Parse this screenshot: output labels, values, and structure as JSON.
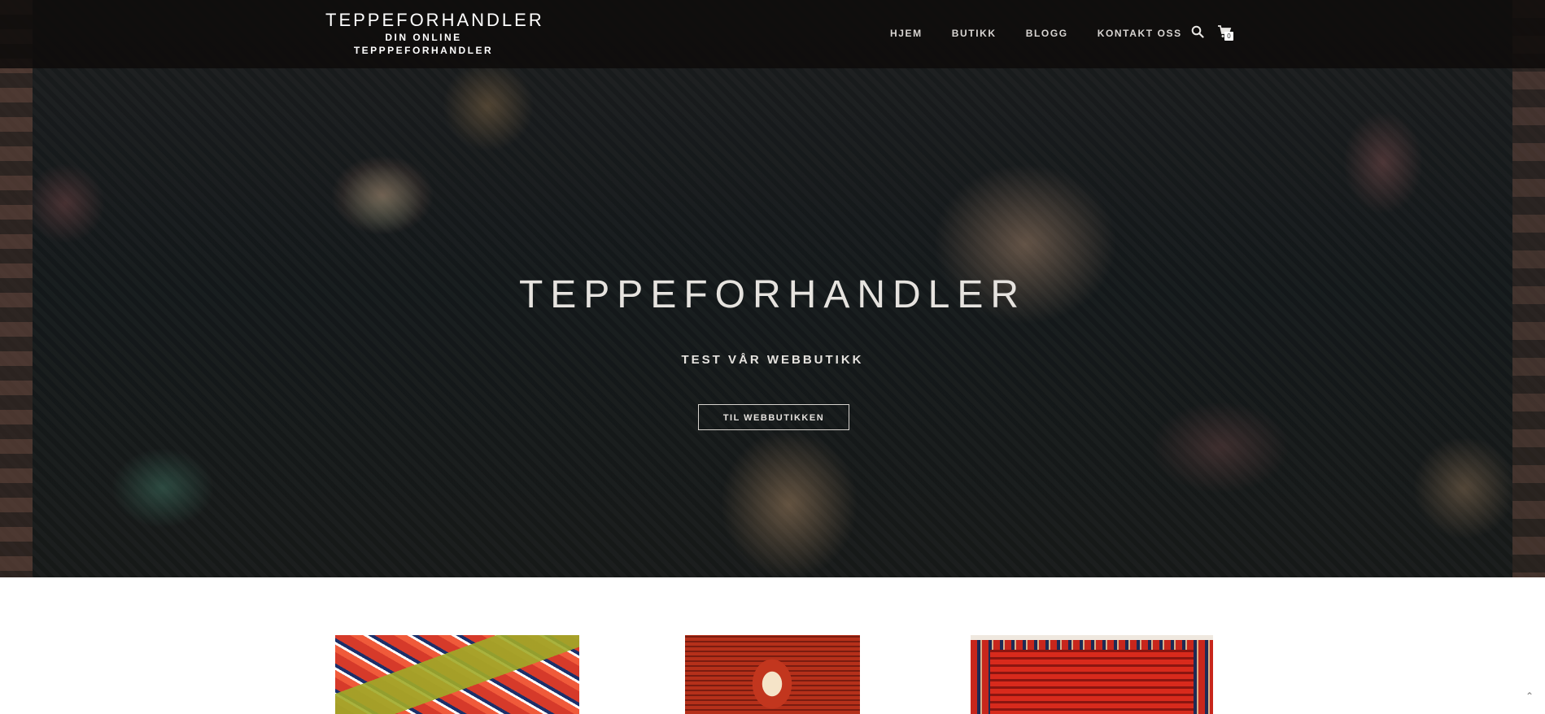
{
  "site": {
    "title": "TEPPEFORHANDLER",
    "tagline": "DIN ONLINE TEPPPEFORHANDLER"
  },
  "nav": {
    "items": [
      "HJEM",
      "BUTIKK",
      "BLOGG",
      "KONTAKT OSS"
    ]
  },
  "header_icons": {
    "search": "search-icon",
    "cart": "cart-icon",
    "cart_count": "0"
  },
  "hero": {
    "title": "TEPPEFORHANDLER",
    "subtitle": "TEST VÅR WEBBUTIKK",
    "button_label": "TIL WEBBUTIKKEN"
  },
  "products": [
    {
      "image": "rug-image"
    },
    {
      "image": "rug-image"
    },
    {
      "image": "rug-image"
    }
  ],
  "scroll_top_icon": "double-chevron-up-icon",
  "colors": {
    "header_bg": "#0e0c0b",
    "hero_text": "#e6e3df",
    "nav_text": "#d8d5d2"
  }
}
